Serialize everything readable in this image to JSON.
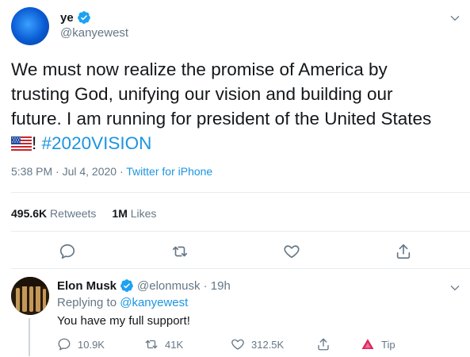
{
  "tweet": {
    "name": "ye",
    "handle": "@kanyewest",
    "text_line1": "We must now realize the promise of America by",
    "text_line2": "trusting God, unifying our vision and building our",
    "text_line3": "future. I am running for president of the United States",
    "text_after_flag": "!",
    "hashtag": "#2020VISION",
    "timestamp": "5:38 PM · Jul 4, 2020 ·",
    "source": "Twitter for iPhone",
    "retweets_count": "495.6K",
    "retweets_label": "Retweets",
    "likes_count": "1M",
    "likes_label": "Likes"
  },
  "reply": {
    "name": "Elon Musk",
    "handle": "@elonmusk · 19h",
    "replying_to_label": "Replying to",
    "replying_to_handle": "@kanyewest",
    "text": "You have my full support!",
    "reply_count": "10.9K",
    "retweet_count": "41K",
    "like_count": "312.5K",
    "tip_label": "Tip"
  },
  "colors": {
    "verified": "#1da1f2",
    "link": "#1b95e0",
    "muted": "#657786",
    "tip": "#e0245e"
  }
}
